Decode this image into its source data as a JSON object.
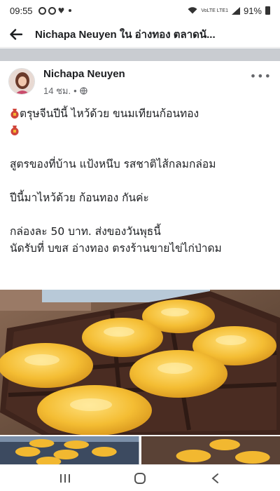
{
  "status_bar": {
    "time": "09:55",
    "battery": "91%",
    "network": "VoLTE LTE1"
  },
  "header": {
    "title": "Nichapa Neuyen ใน อ่างทอง ตลาดนั..."
  },
  "post": {
    "author": "Nichapa Neuyen",
    "time": "14 ชม.",
    "separator": "•",
    "more": "•••",
    "paragraphs": [
      "ตรุษจีนปีนี้ ไหว้ด้วย ขนมเทียนก้อนทอง",
      "สูตรของที่บ้าน แป้งหนึบ รสชาติไส้กลมกล่อม",
      "ปีนี้มาไหว้ด้วย ก้อนทอง กันค่ะ",
      "กล่องละ 50 บาท. ส่งของวันพุธนี้",
      "นัดรับที่ บขส อ่างทอง ตรงร้านขายไข่ไก่ป่าดม"
    ]
  },
  "colors": {
    "pot_red": "#d0453b",
    "gold": "#f2b830",
    "tray": "#4a2c22"
  }
}
